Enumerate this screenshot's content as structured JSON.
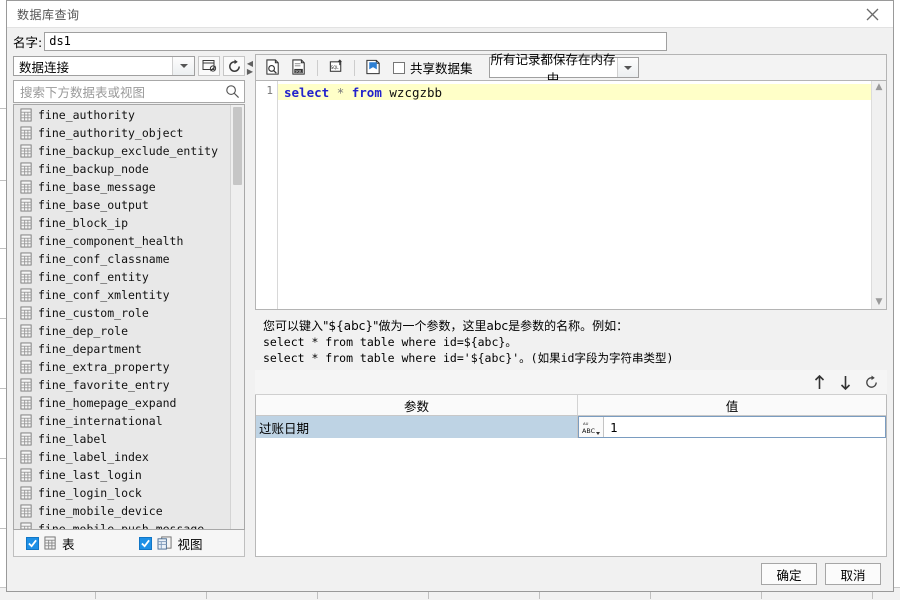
{
  "window": {
    "title": "数据库查询",
    "close_label": "×"
  },
  "name_row": {
    "label": "名字:",
    "value": "ds1"
  },
  "connection": {
    "selected": "数据连接",
    "edit_icon": "edit-connection-icon",
    "refresh_icon": "refresh-icon"
  },
  "search": {
    "placeholder": "搜索下方数据表或视图",
    "icon": "search-icon"
  },
  "tables": [
    "fine_authority",
    "fine_authority_object",
    "fine_backup_exclude_entity",
    "fine_backup_node",
    "fine_base_message",
    "fine_base_output",
    "fine_block_ip",
    "fine_component_health",
    "fine_conf_classname",
    "fine_conf_entity",
    "fine_conf_xmlentity",
    "fine_custom_role",
    "fine_dep_role",
    "fine_department",
    "fine_extra_property",
    "fine_favorite_entry",
    "fine_homepage_expand",
    "fine_international",
    "fine_label",
    "fine_label_index",
    "fine_last_login",
    "fine_login_lock",
    "fine_mobile_device",
    "fine_mobile_push_message"
  ],
  "filters": {
    "table": {
      "label": "表",
      "checked": true,
      "icon": "table-icon"
    },
    "view": {
      "label": "视图",
      "checked": true,
      "icon": "view-icon"
    }
  },
  "toolbar": {
    "preview_icon": "preview-page-icon",
    "sql_doc_icon": "sql-document-icon",
    "sql_up_icon": "sql-upload-icon",
    "flag_icon": "blue-flag-icon",
    "shared_dataset": {
      "label": "共享数据集",
      "checked": false
    },
    "memory_mode": "所有记录都保存在内存中"
  },
  "editor": {
    "line_number": "1",
    "sql": {
      "kw1": "select",
      "star": "*",
      "kw2": "from",
      "table": "wzcgzbb"
    }
  },
  "hint": {
    "line1": "您可以键入\"${abc}\"做为一个参数，这里abc是参数的名称。例如：",
    "line2": "select * from table where id=${abc}。",
    "line3": "select * from table where id='${abc}'。(如果id字段为字符串类型)"
  },
  "param_toolbar": {
    "move_up_icon": "arrow-up-icon",
    "move_down_icon": "arrow-down-icon",
    "refresh_icon": "refresh-icon"
  },
  "param_table": {
    "headers": [
      "参数",
      "值"
    ],
    "rows": [
      {
        "name": "过账日期",
        "type_icon": "abc-type-icon",
        "value": "1"
      }
    ]
  },
  "footer": {
    "ok": "确定",
    "cancel": "取消"
  },
  "colors": {
    "accent": "#1e90e6",
    "selection": "#bed3e4",
    "code_line_highlight": "#ffffc8",
    "keyword": "#2222cc"
  }
}
